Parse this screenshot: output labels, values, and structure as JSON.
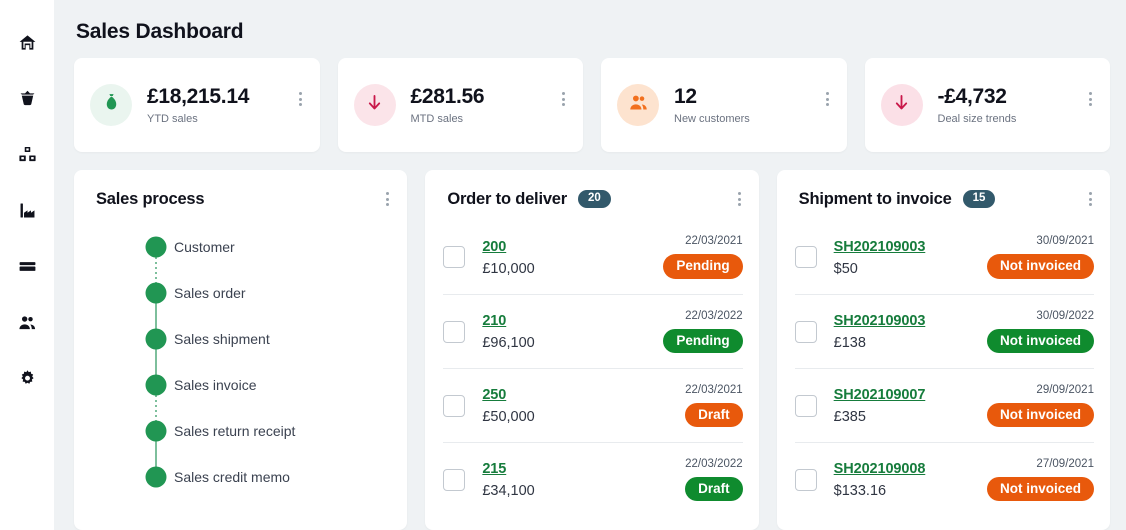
{
  "sidebar": {
    "items": [
      {
        "name": "home-icon",
        "label": "Home"
      },
      {
        "name": "basket-icon",
        "label": "Sales"
      },
      {
        "name": "boxes-icon",
        "label": "Items"
      },
      {
        "name": "factory-icon",
        "label": "Manufacturing"
      },
      {
        "name": "card-icon",
        "label": "Finance"
      },
      {
        "name": "people-icon",
        "label": "Customers"
      },
      {
        "name": "gear-icon",
        "label": "Settings"
      }
    ]
  },
  "header": {
    "title": "Sales Dashboard"
  },
  "kpis": [
    {
      "value": "£18,215.14",
      "label": "YTD sales",
      "icon": "money-bag-icon",
      "circle_color": "#eaf5ef",
      "icon_color": "#219653",
      "menu": "kpi-menu"
    },
    {
      "value": "£281.56",
      "label": "MTD sales",
      "icon": "arrow-down-icon",
      "circle_color": "#fbe4e9",
      "icon_color": "#c9184a",
      "menu": "kpi-menu"
    },
    {
      "value": "12",
      "label": "New customers",
      "icon": "people-icon",
      "circle_color": "#fde3cf",
      "icon_color": "#f2701e",
      "menu": "kpi-menu"
    },
    {
      "value": "-£4,732",
      "label": "Deal size trends",
      "icon": "arrow-down-icon",
      "circle_color": "#fbe0e7",
      "icon_color": "#c9184a",
      "menu": "kpi-menu"
    }
  ],
  "sales_process": {
    "title": "Sales process",
    "steps": [
      {
        "label": "Customer",
        "connector": "dotted"
      },
      {
        "label": "Sales order",
        "connector": "solid"
      },
      {
        "label": "Sales shipment",
        "connector": "solid"
      },
      {
        "label": "Sales invoice",
        "connector": "dotted"
      },
      {
        "label": "Sales return receipt",
        "connector": "solid"
      },
      {
        "label": "Sales credit memo",
        "connector": "none"
      }
    ],
    "node_color": "#219653",
    "connector_color": "#7dbf9c"
  },
  "order_to_deliver": {
    "title": "Order to deliver",
    "badge": "20",
    "rows": [
      {
        "id": "200",
        "amount": "£10,000",
        "date": "22/03/2021",
        "status": "Pending",
        "status_color": "orange"
      },
      {
        "id": "210",
        "amount": "£96,100",
        "date": "22/03/2022",
        "status": "Pending",
        "status_color": "green"
      },
      {
        "id": "250",
        "amount": "£50,000",
        "date": "22/03/2021",
        "status": "Draft",
        "status_color": "orange"
      },
      {
        "id": "215",
        "amount": "£34,100",
        "date": "22/03/2022",
        "status": "Draft",
        "status_color": "green"
      }
    ]
  },
  "shipment_to_invoice": {
    "title": "Shipment to invoice",
    "badge": "15",
    "rows": [
      {
        "id": "SH202109003",
        "amount": "$50",
        "date": "30/09/2021",
        "status": "Not invoiced",
        "status_color": "orange"
      },
      {
        "id": "SH202109003",
        "amount": "£138",
        "date": "30/09/2022",
        "status": "Not invoiced",
        "status_color": "green"
      },
      {
        "id": "SH202109007",
        "amount": "£385",
        "date": "29/09/2021",
        "status": "Not invoiced",
        "status_color": "orange"
      },
      {
        "id": "SH202109008",
        "amount": "$133.16",
        "date": "27/09/2021",
        "status": "Not invoiced",
        "status_color": "orange"
      }
    ]
  },
  "colors": {
    "background": "#eff2f4",
    "card": "#ffffff",
    "badge": "#32596b",
    "link": "#167c3c",
    "orange": "#e8590c",
    "green": "#0f8b2e"
  }
}
